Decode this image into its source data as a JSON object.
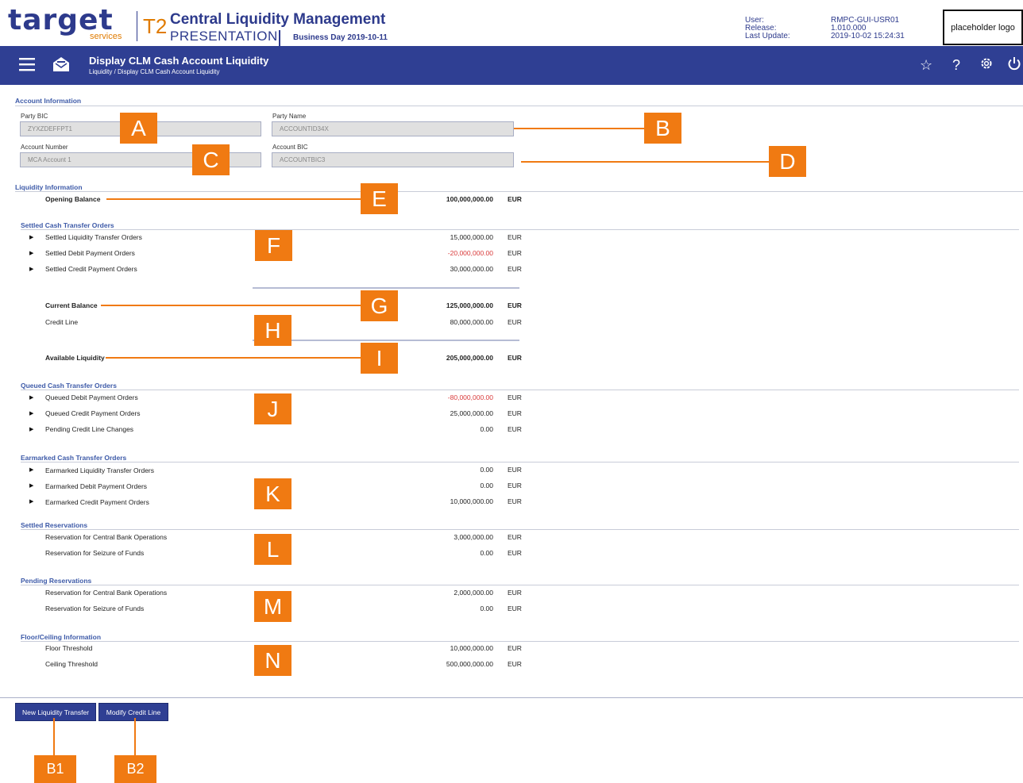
{
  "header": {
    "brand": "target",
    "brand_sub": "services",
    "t2": "T2",
    "app_title": "Central Liquidity Management",
    "environment": "PRESENTATION",
    "business_day": "Business Day 2019-10-11",
    "user_label": "User:",
    "user_value": "RMPC-GUI-USR01",
    "release_label": "Release:",
    "release_value": "1.010.000",
    "last_update_label": "Last Update:",
    "last_update_value": "2019-10-02 15:24:31",
    "logo_placeholder": "placeholder logo"
  },
  "toolbar": {
    "page_title": "Display CLM Cash Account Liquidity",
    "breadcrumb": "Liquidity  /  Display CLM Cash Account Liquidity",
    "icons": [
      "menu-icon",
      "inbox-icon",
      "star-icon",
      "help-icon",
      "settings-icon",
      "power-icon"
    ]
  },
  "account": {
    "section": "Account Information",
    "party_bic_label": "Party BIC",
    "party_bic_value": "ZYXZDEFFPT1",
    "party_name_label": "Party Name",
    "party_name_value": "ACCOUNTID34X",
    "account_number_label": "Account Number",
    "account_number_value": "MCA Account 1",
    "account_bic_label": "Account BIC",
    "account_bic_value": "ACCOUNTBIC3"
  },
  "liquidity": {
    "section": "Liquidity Information",
    "opening_balance_label": "Opening Balance",
    "opening_balance_value": "100,000,000.00",
    "currency": "EUR"
  },
  "settled": {
    "section": "Settled Cash Transfer Orders",
    "rows": [
      {
        "label": "Settled Liquidity Transfer Orders",
        "value": "15,000,000.00",
        "currency": "EUR"
      },
      {
        "label": "Settled Debit Payment Orders",
        "value": "-20,000,000.00",
        "currency": "EUR"
      },
      {
        "label": "Settled Credit Payment Orders",
        "value": "30,000,000.00",
        "currency": "EUR"
      }
    ]
  },
  "balances": {
    "current_balance_label": "Current Balance",
    "current_balance_value": "125,000,000.00",
    "credit_line_label": "Credit Line",
    "credit_line_value": "80,000,000.00",
    "available_liquidity_label": "Available Liquidity",
    "available_liquidity_value": "205,000,000.00",
    "currency": "EUR"
  },
  "queued": {
    "section": "Queued Cash Transfer Orders",
    "rows": [
      {
        "label": "Queued Debit Payment Orders",
        "value": "-80,000,000.00",
        "currency": "EUR"
      },
      {
        "label": "Queued Credit Payment Orders",
        "value": "25,000,000.00",
        "currency": "EUR"
      },
      {
        "label": "Pending Credit Line Changes",
        "value": "0.00",
        "currency": "EUR"
      }
    ]
  },
  "earmarked": {
    "section": "Earmarked Cash Transfer Orders",
    "rows": [
      {
        "label": "Earmarked Liquidity Transfer Orders",
        "value": "0.00",
        "currency": "EUR"
      },
      {
        "label": "Earmarked Debit Payment Orders",
        "value": "0.00",
        "currency": "EUR"
      },
      {
        "label": "Earmarked Credit Payment Orders",
        "value": "10,000,000.00",
        "currency": "EUR"
      }
    ]
  },
  "settled_reservations": {
    "section": "Settled Reservations",
    "rows": [
      {
        "label": "Reservation for Central Bank Operations",
        "value": "3,000,000.00",
        "currency": "EUR"
      },
      {
        "label": "Reservation for Seizure of Funds",
        "value": "0.00",
        "currency": "EUR"
      }
    ]
  },
  "pending_reservations": {
    "section": "Pending Reservations",
    "rows": [
      {
        "label": "Reservation for Central Bank Operations",
        "value": "2,000,000.00",
        "currency": "EUR"
      },
      {
        "label": "Reservation for Seizure of Funds",
        "value": "0.00",
        "currency": "EUR"
      }
    ]
  },
  "floor_ceiling": {
    "section": "Floor/Ceiling Information",
    "rows": [
      {
        "label": "Floor Threshold",
        "value": "10,000,000.00",
        "currency": "EUR"
      },
      {
        "label": "Ceiling Threshold",
        "value": "500,000,000.00",
        "currency": "EUR"
      }
    ]
  },
  "buttons": {
    "new_liquidity_transfer": "New Liquidity Transfer",
    "modify_credit_line": "Modify Credit Line"
  },
  "annotations": {
    "a": "A",
    "b": "B",
    "c": "C",
    "d": "D",
    "e": "E",
    "f": "F",
    "g": "G",
    "h": "H",
    "i": "I",
    "j": "J",
    "k": "K",
    "l": "L",
    "m": "M",
    "n": "N",
    "b1": "B1",
    "b2": "B2"
  },
  "colors": {
    "brand_blue": "#2d3a8c",
    "bar_blue": "#2f3f93",
    "accent_orange": "#f07a12",
    "section_blue": "#3d5aa8",
    "negative_red": "#d93a3a"
  }
}
